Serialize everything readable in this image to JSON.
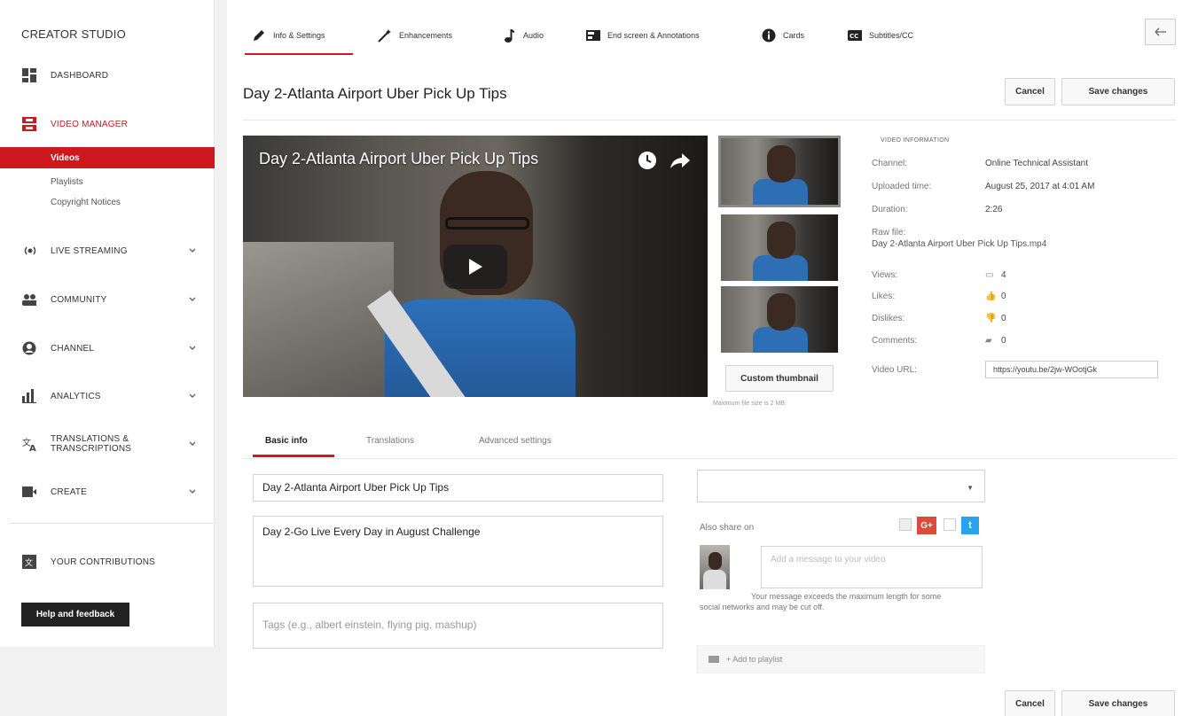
{
  "sidebar": {
    "title": "CREATOR STUDIO",
    "items": [
      {
        "label": "DASHBOARD"
      },
      {
        "label": "VIDEO MANAGER"
      },
      {
        "label": "LIVE STREAMING"
      },
      {
        "label": "COMMUNITY"
      },
      {
        "label": "CHANNEL"
      },
      {
        "label": "ANALYTICS"
      },
      {
        "label": "TRANSLATIONS &",
        "label2": "TRANSCRIPTIONS"
      },
      {
        "label": "CREATE"
      },
      {
        "label": "YOUR CONTRIBUTIONS"
      }
    ],
    "subitems": [
      "Videos",
      "Playlists",
      "Copyright Notices"
    ],
    "help_label": "Help and feedback"
  },
  "tabs": [
    "Info & Settings",
    "Enhancements",
    "Audio",
    "End screen & Annotations",
    "Cards",
    "Subtitles/CC"
  ],
  "video_title": "Day 2-Atlanta Airport Uber Pick Up Tips",
  "actions": {
    "cancel": "Cancel",
    "save": "Save changes"
  },
  "player_title": "Day 2-Atlanta Airport Uber Pick Up Tips",
  "custom_thumbnail": "Custom thumbnail",
  "max_file_size": "Maximum file size is 2 MB.",
  "video_info": {
    "heading": "VIDEO INFORMATION",
    "channel_label": "Channel:",
    "channel": "Online Technical Assistant",
    "uploaded_label": "Uploaded time:",
    "uploaded": "August 25, 2017 at 4:01 AM",
    "duration_label": "Duration:",
    "duration": "2:26",
    "raw_label": "Raw file:",
    "raw_file": "Day 2-Atlanta Airport Uber Pick Up Tips.mp4",
    "views_label": "Views:",
    "views": "4",
    "likes_label": "Likes:",
    "likes": "0",
    "dislikes_label": "Dislikes:",
    "dislikes": "0",
    "comments_label": "Comments:",
    "comments": "0",
    "url_label": "Video URL:",
    "url": "https://youtu.be/2jw-WOotjGk"
  },
  "subtabs": [
    "Basic info",
    "Translations",
    "Advanced settings"
  ],
  "form": {
    "title_value": "Day 2-Atlanta Airport Uber Pick Up Tips",
    "description_value": "Day 2-Go Live Every Day in August Challenge",
    "tags_placeholder": "Tags (e.g., albert einstein, flying pig, mashup)",
    "privacy_value": "",
    "also_share": "Also share on",
    "gplus": "G+",
    "message_placeholder": "Add a message to your video",
    "warning": "Your message exceeds the maximum length for some social networks and may be cut off.",
    "add_playlist": "+ Add to playlist"
  },
  "colors": {
    "accent": "#cc181e",
    "twitter": "#2aa3ef",
    "gplus": "#dd4b39"
  }
}
